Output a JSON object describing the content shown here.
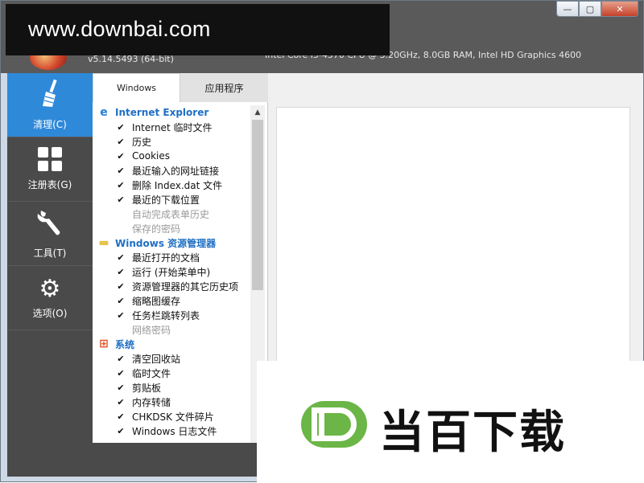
{
  "app": {
    "version": "v5.14.5493 (64-bit)",
    "sysinfo": "Intel Core i5-4570 CPU @ 3.20GHz, 8.0GB RAM, Intel HD Graphics 4600",
    "window_controls": {
      "minimize": "—",
      "maximize": "▢",
      "close": "✕"
    }
  },
  "watermarks": {
    "top_text": "www.downbai.com",
    "brand_letter": "D",
    "brand_text": "当百下载"
  },
  "sidebar": {
    "items": [
      {
        "label": "清理(C)",
        "icon": "broom-icon",
        "active": true
      },
      {
        "label": "注册表(G)",
        "icon": "grid-icon",
        "active": false
      },
      {
        "label": "工具(T)",
        "icon": "wrench-icon",
        "active": false
      },
      {
        "label": "选项(O)",
        "icon": "gear-icon",
        "active": false
      }
    ]
  },
  "tabs": {
    "windows": "Windows",
    "apps": "应用程序"
  },
  "cleaner": {
    "sections": [
      {
        "title": "Internet Explorer",
        "icon": "ie-icon",
        "items": [
          {
            "label": "Internet 临时文件",
            "checked": true
          },
          {
            "label": "历史",
            "checked": true
          },
          {
            "label": "Cookies",
            "checked": true
          },
          {
            "label": "最近输入的网址链接",
            "checked": true
          },
          {
            "label": "删除 Index.dat 文件",
            "checked": true
          },
          {
            "label": "最近的下载位置",
            "checked": true
          },
          {
            "label": "自动完成表单历史",
            "checked": false
          },
          {
            "label": "保存的密码",
            "checked": false
          }
        ]
      },
      {
        "title": "Windows 资源管理器",
        "icon": "folder-icon",
        "items": [
          {
            "label": "最近打开的文档",
            "checked": true
          },
          {
            "label": "运行 (开始菜单中)",
            "checked": true
          },
          {
            "label": "资源管理器的其它历史项",
            "checked": true
          },
          {
            "label": "缩略图缓存",
            "checked": true
          },
          {
            "label": "任务栏跳转列表",
            "checked": true
          },
          {
            "label": "网络密码",
            "checked": false
          }
        ]
      },
      {
        "title": "系统",
        "icon": "windows-icon",
        "items": [
          {
            "label": "清空回收站",
            "checked": true
          },
          {
            "label": "临时文件",
            "checked": true
          },
          {
            "label": "剪贴板",
            "checked": true
          },
          {
            "label": "内存转储",
            "checked": true
          },
          {
            "label": "CHKDSK 文件碎片",
            "checked": true
          },
          {
            "label": "Windows 日志文件",
            "checked": true
          }
        ]
      }
    ]
  },
  "colors": {
    "accent": "#2f89d9",
    "sidebar": "#4a4a4a",
    "category": "#1f6fc4",
    "brand_green": "#6bb646"
  }
}
